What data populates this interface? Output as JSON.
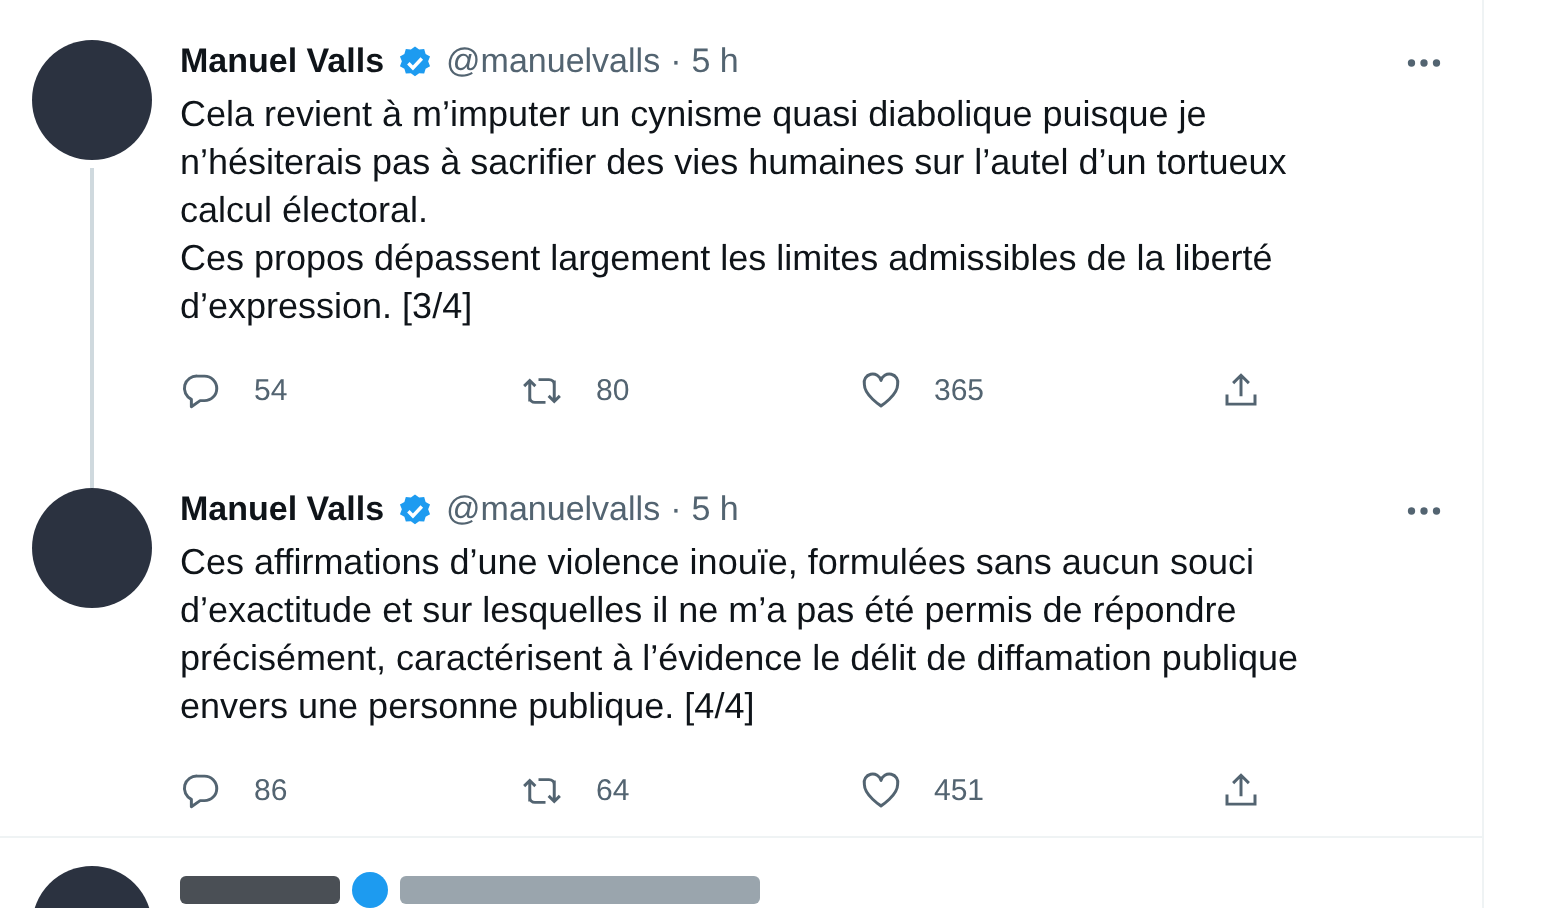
{
  "tweets": [
    {
      "name": "Manuel Valls",
      "verified": true,
      "handle": "@manuelvalls",
      "separator": "·",
      "time": "5 h",
      "thread_line": true,
      "text": "Cela revient à m’imputer un cynisme quasi diabolique puisque je n’hésiterais pas à sacrifier des vies humaines sur l’autel d’un tortueux calcul électoral.\nCes propos dépassent largement les limites admissibles de la liberté d’expression. [3/4]",
      "replies": "54",
      "retweets": "80",
      "likes": "365"
    },
    {
      "name": "Manuel Valls",
      "verified": true,
      "handle": "@manuelvalls",
      "separator": "·",
      "time": "5 h",
      "thread_line": false,
      "text": "Ces affirmations d’une violence inouïe, formulées sans aucun souci d’exactitude et sur lesquelles il ne m’a pas été permis de répondre précisément, caractérisent à l’évidence le délit de diffamation publique envers une personne publique. [4/4]",
      "replies": "86",
      "retweets": "64",
      "likes": "451"
    }
  ],
  "next_tweet": {
    "verified": true
  }
}
